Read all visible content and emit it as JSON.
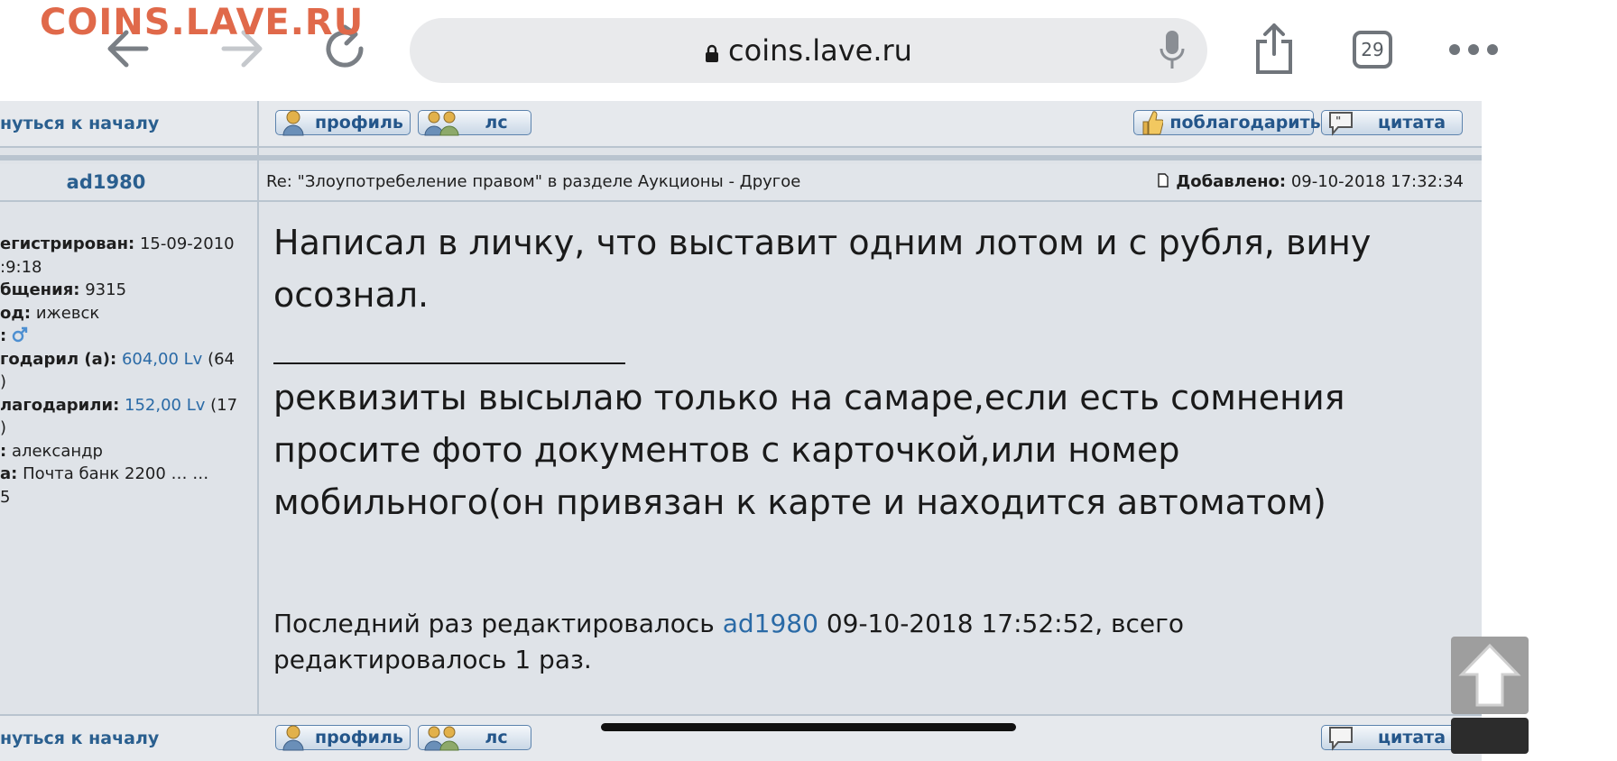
{
  "browser": {
    "watermark": "COINS.LAVE.RU",
    "url": "coins.lave.ru",
    "tab_count": "29"
  },
  "toolbar": {
    "back_to_top": "нуться к началу",
    "profile": "профиль",
    "pm": "лс",
    "thank": "поблагодарить",
    "quote": "цитата"
  },
  "post": {
    "username": "ad1980",
    "subject": "Re: \"Злоупотребеление правом\" в разделе Аукционы - Другое",
    "added_label": "Добавлено:",
    "added_value": "09-10-2018 17:32:34",
    "body": "Написал в личку, что выставит одним лотом и с рубля, вину осознал.",
    "signature": "реквизиты высылаю только на самаре,если есть сомнения просите фото документов с карточкой,или номер мобильного(он привязан к карте и находится автоматом)",
    "edit_prefix": "Последний раз редактировалось",
    "edit_user": "ad1980",
    "edit_suffix": "09-10-2018 17:52:52, всего редактировалось 1 раз."
  },
  "user_info": {
    "registered_label": "егистрирован:",
    "registered_value": "15-09-2010",
    "registered_time": ":9:18",
    "messages_label": "бщения:",
    "messages_value": "9315",
    "city_label": "од:",
    "city_value": "ижевск",
    "gender_label": ":",
    "thanked_label": "годарил (а):",
    "thanked_value": "604,00 Lv",
    "thanked_count": "(64",
    "thanked_count_end": ")",
    "was_thanked_label": "лагодарили:",
    "was_thanked_value": "152,00 Lv",
    "was_thanked_count": "(17",
    "was_thanked_count_end": ")",
    "name_label": ":",
    "name_value": "александр",
    "card_label": "а:",
    "card_value": "Почта банк 2200 … …",
    "card_tail": "5"
  },
  "colors": {
    "link": "#2a6aa6",
    "username": "#2a5f8f",
    "watermark": "#e0694a",
    "forum_bg": "#dfe3e8",
    "border": "#b9c4cf"
  },
  "icons": [
    "back-arrow-icon",
    "forward-arrow-icon",
    "reload-icon",
    "lock-icon",
    "mic-icon",
    "share-icon",
    "tabs-icon",
    "more-icon",
    "document-icon",
    "male-icon",
    "scroll-up-icon"
  ]
}
